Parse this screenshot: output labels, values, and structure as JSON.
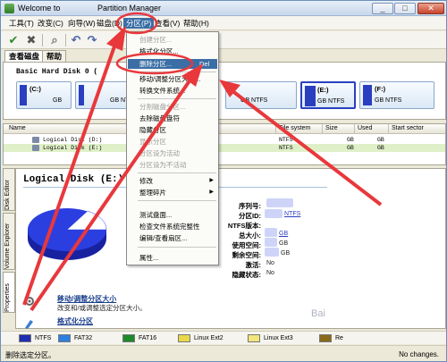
{
  "window": {
    "title_left": "Welcome to",
    "title_right": "Partition Manager"
  },
  "menu": [
    {
      "label": "工具(T)"
    },
    {
      "label": "改变(C)"
    },
    {
      "label": "向导(W)"
    },
    {
      "label": "磁盘(D)"
    },
    {
      "label": "分区(P)"
    },
    {
      "label": "查看(V)"
    },
    {
      "label": "帮助(H)"
    }
  ],
  "tabs": [
    {
      "label": "查看磁盘"
    },
    {
      "label": "帮助"
    }
  ],
  "diskmap": {
    "disk_label": "Basic Hard Disk 0 (",
    "partitions": [
      {
        "name": "(C:)",
        "info": "GB"
      },
      {
        "name": "",
        "info": "GB NTFS"
      },
      {
        "name": "",
        "info": "GB NTFS"
      },
      {
        "name": "(E:)",
        "info": "GB NTFS"
      },
      {
        "name": "(F:)",
        "info": "GB NTFS"
      }
    ]
  },
  "list": {
    "columns": [
      "Name",
      "File system",
      "Size",
      "Used",
      "Start sector"
    ],
    "rows": [
      {
        "name": "Logical Disk (D:)",
        "fs": "NTFS",
        "size": "GB",
        "used": "GB"
      },
      {
        "name": "Logical Disk (E:)",
        "fs": "NTFS",
        "size": "GB",
        "used": "GB"
      }
    ]
  },
  "vtabs": [
    "Disk Editor",
    "Volume Explorer",
    "Properties"
  ],
  "details": {
    "title": "Logical Disk (E:)",
    "props": [
      {
        "label": "序列号:",
        "value": ""
      },
      {
        "label": "分区ID:",
        "value": "NTFS"
      },
      {
        "label": "NTFS版本:",
        "value": ""
      },
      {
        "label": "总大小:",
        "value": "GB"
      },
      {
        "label": "使用空间:",
        "value": "GB"
      },
      {
        "label": "剩余空间:",
        "value": "GB"
      },
      {
        "label": "激活:",
        "value": "No"
      },
      {
        "label": "隐藏状态:",
        "value": "No"
      }
    ],
    "actions": [
      {
        "title": "移动/调整分区大小",
        "desc": "改变和/或调整选定分区大小。"
      },
      {
        "title": "格式化分区",
        "desc": ""
      }
    ]
  },
  "legend": [
    {
      "label": "NTFS",
      "color": "#1f2fb0"
    },
    {
      "label": "FAT32",
      "color": "#2f7fe0"
    },
    {
      "label": "FAT16",
      "color": "#1e8a2a"
    },
    {
      "label": "Linux Ext2",
      "color": "#e8d84a"
    },
    {
      "label": "Linux Ext3",
      "color": "#f2e67a"
    },
    {
      "label": "Re",
      "color": "#8a6a1a"
    }
  ],
  "status": {
    "left": "删除选定分区。",
    "right": "No changes."
  },
  "dropdown": {
    "items": [
      {
        "label": "创建分区...",
        "disabled": true
      },
      {
        "label": "格式化分区...",
        "disabled": false
      },
      {
        "label": "删除分区...",
        "shortcut": "Del",
        "highlighted": true
      },
      {
        "label": "移动/调整分区大小...",
        "disabled": false
      },
      {
        "label": "转换文件系统...",
        "disabled": false
      },
      {
        "label": "分割磁盘分区...",
        "disabled": true
      },
      {
        "label": "去除磁盘盘符",
        "disabled": false
      },
      {
        "label": "隐藏分区",
        "disabled": false
      },
      {
        "label": "显示分区",
        "disabled": true
      },
      {
        "label": "分区设为活动",
        "disabled": true
      },
      {
        "label": "分区设为不活动",
        "disabled": true
      },
      {
        "label": "修改",
        "submenu": true
      },
      {
        "label": "整理碎片",
        "submenu": true
      },
      {
        "label": "测试盘面...",
        "disabled": false
      },
      {
        "label": "检查文件系统完整性",
        "disabled": false
      },
      {
        "label": "编辑/查看扇区...",
        "disabled": false
      },
      {
        "label": "属性...",
        "disabled": false
      }
    ]
  },
  "accent": "#3a6ea5",
  "annotation_color": "#e8383c"
}
